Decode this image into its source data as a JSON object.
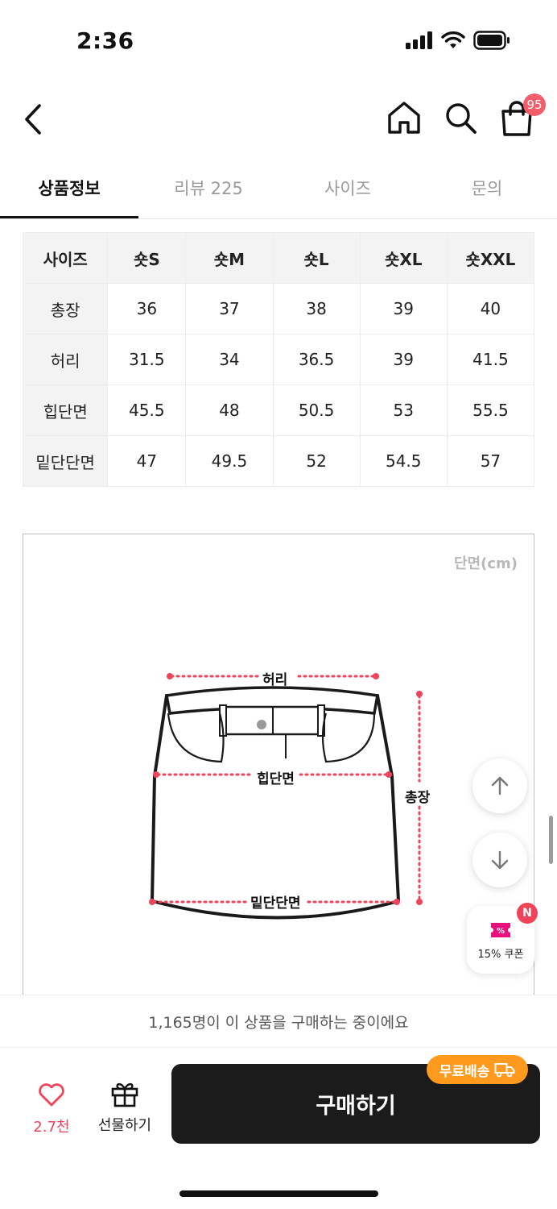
{
  "status": {
    "time": "2:36"
  },
  "nav": {
    "cart_badge": "95"
  },
  "tabs": [
    {
      "label": "상품정보"
    },
    {
      "label": "리뷰 225"
    },
    {
      "label": "사이즈"
    },
    {
      "label": "문의"
    }
  ],
  "size_table": {
    "headers": [
      "사이즈",
      "숏S",
      "숏M",
      "숏L",
      "숏XL",
      "숏XXL"
    ],
    "rows": [
      {
        "label": "총장",
        "values": [
          "36",
          "37",
          "38",
          "39",
          "40"
        ]
      },
      {
        "label": "허리",
        "values": [
          "31.5",
          "34",
          "36.5",
          "39",
          "41.5"
        ]
      },
      {
        "label": "힙단면",
        "values": [
          "45.5",
          "48",
          "50.5",
          "53",
          "55.5"
        ]
      },
      {
        "label": "밑단단면",
        "values": [
          "47",
          "49.5",
          "52",
          "54.5",
          "57"
        ]
      }
    ]
  },
  "diagram": {
    "unit": "단면(cm)",
    "labels": {
      "waist": "허리",
      "hip": "힙단면",
      "length": "총장",
      "hem": "밑단단면"
    }
  },
  "coupon": {
    "label": "15% 쿠폰",
    "badge": "N"
  },
  "buyers_text": "1,165명이 이 상품을 구매하는 중이에요",
  "bottom": {
    "like_count": "2.7천",
    "gift_label": "선물하기",
    "buy_label": "구매하기",
    "free_shipping": "무료배송"
  },
  "colors": {
    "accent": "#f0445b",
    "buy_button": "#1b1b1b",
    "free_shipping": "#ff9a1f"
  }
}
